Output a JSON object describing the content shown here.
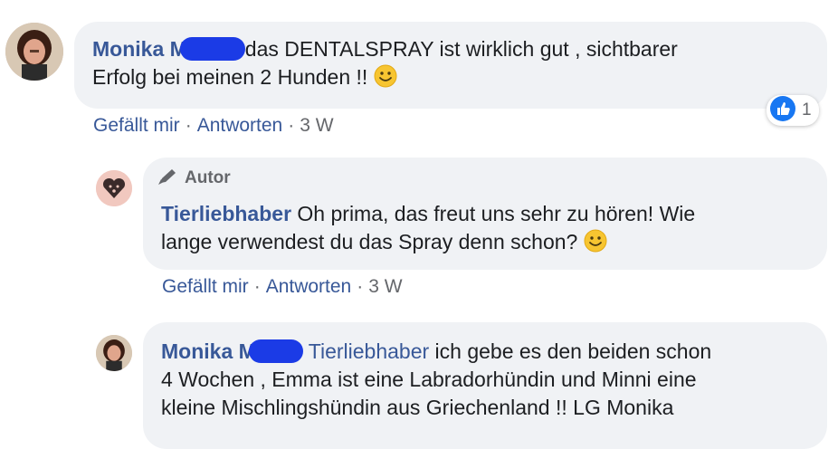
{
  "comments": [
    {
      "author": "Monika M",
      "text_line1": "das DENTALSPRAY ist wirklich gut , sichtbarer",
      "text_line2": "Erfolg bei meinen 2 Hunden !!",
      "reaction_count": "1",
      "actions": {
        "like": "Gefällt mir",
        "reply": "Antworten",
        "time": "3 W"
      }
    },
    {
      "badge": "Autor",
      "author": "Tierliebhaber",
      "text_line1": "Oh prima, das freut uns sehr zu hören! Wie",
      "text_line2": "lange verwendest du das Spray denn schon?",
      "actions": {
        "like": "Gefällt mir",
        "reply": "Antworten",
        "time": "3 W"
      }
    },
    {
      "author": "Monika M",
      "mention": "Tierliebhaber",
      "text_line1": "ich gebe es den beiden schon",
      "text_line2": "4 Wochen , Emma ist eine Labradorhündin und Minni eine",
      "text_line3": "kleine Mischlingshündin aus Griechenland !! LG Monika"
    }
  ],
  "separator": "·",
  "colors": {
    "link": "#385898",
    "bubble": "#f0f2f5",
    "meta": "#65676b",
    "like_blue": "#1877f2"
  },
  "icons": [
    "smiley-emoji-icon",
    "pencil-icon",
    "thumbs-up-icon"
  ]
}
